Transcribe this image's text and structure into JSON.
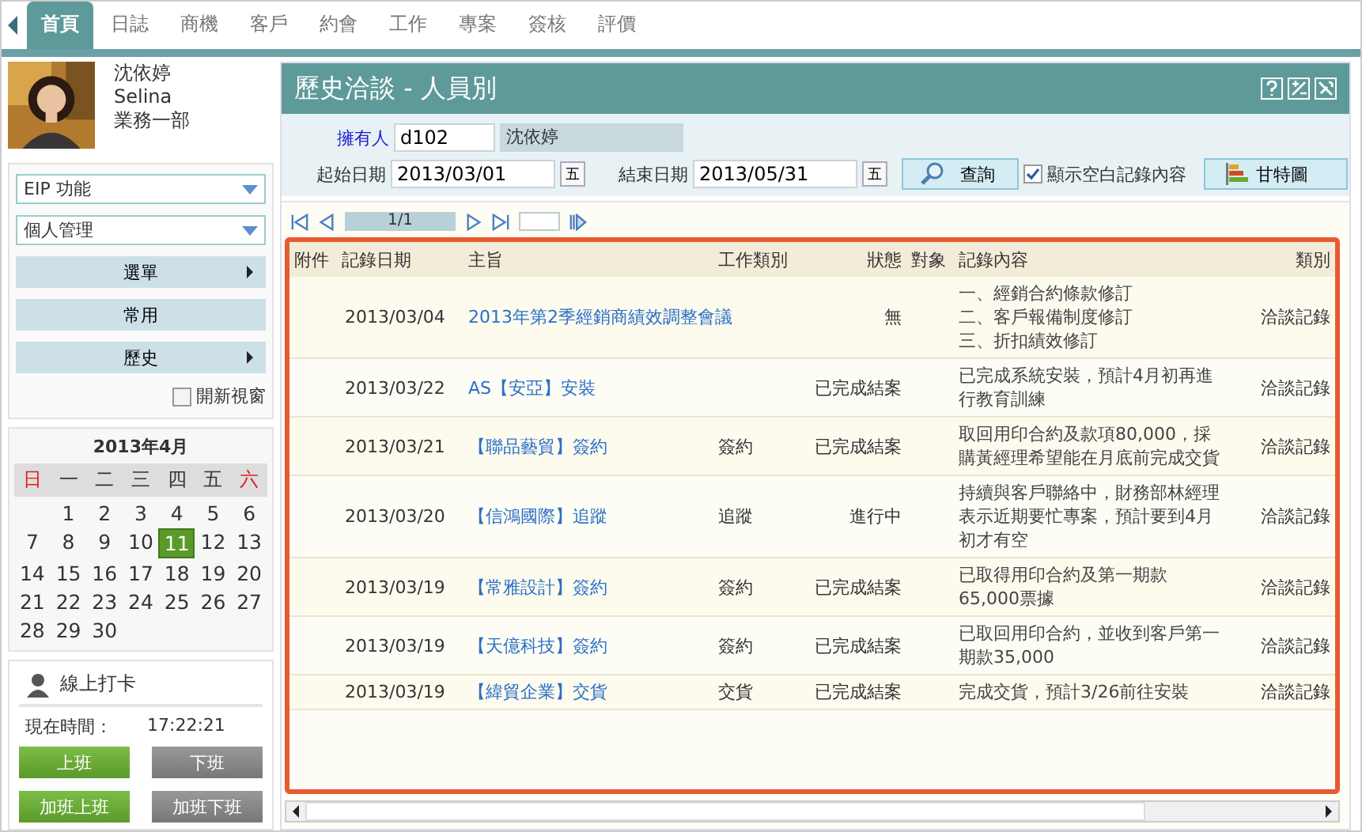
{
  "tabs": [
    {
      "label": "首頁",
      "selected": true
    },
    {
      "label": "日誌",
      "selected": false
    },
    {
      "label": "商機",
      "selected": false
    },
    {
      "label": "客戶",
      "selected": false
    },
    {
      "label": "約會",
      "selected": false
    },
    {
      "label": "工作",
      "selected": false
    },
    {
      "label": "專案",
      "selected": false
    },
    {
      "label": "簽核",
      "selected": false
    },
    {
      "label": "評價",
      "selected": false
    }
  ],
  "profile": {
    "name": "沈依婷",
    "english_name": "Selina",
    "department": "業務一部"
  },
  "sidebar": {
    "selects": [
      "EIP 功能",
      "個人管理"
    ],
    "menu": [
      {
        "label": "選單",
        "has_arrow": true
      },
      {
        "label": "常用",
        "has_arrow": false
      },
      {
        "label": "歷史",
        "has_arrow": true
      }
    ],
    "new_window": {
      "label": "開新視窗",
      "checked": false
    }
  },
  "calendar": {
    "title": "2013年4月",
    "weekdays": [
      {
        "label": "日",
        "color": "#e02020"
      },
      {
        "label": "一",
        "color": "#333333"
      },
      {
        "label": "二",
        "color": "#333333"
      },
      {
        "label": "三",
        "color": "#333333"
      },
      {
        "label": "四",
        "color": "#333333"
      },
      {
        "label": "五",
        "color": "#333333"
      },
      {
        "label": "六",
        "color": "#e02020"
      }
    ],
    "weeks": [
      [
        {
          "day": "1",
          "selected": false
        },
        {
          "day": "2",
          "selected": false
        },
        {
          "day": "3",
          "selected": false
        },
        {
          "day": "4",
          "selected": false
        },
        {
          "day": "5",
          "selected": false
        },
        {
          "day": "6",
          "selected": false
        }
      ],
      [
        {
          "day": "7",
          "selected": false
        },
        {
          "day": "8",
          "selected": false
        },
        {
          "day": "9",
          "selected": false
        },
        {
          "day": "10",
          "selected": false
        },
        {
          "day": "11",
          "selected": true
        },
        {
          "day": "12",
          "selected": false
        },
        {
          "day": "13",
          "selected": false
        }
      ],
      [
        {
          "day": "14",
          "selected": false
        },
        {
          "day": "15",
          "selected": false
        },
        {
          "day": "16",
          "selected": false
        },
        {
          "day": "17",
          "selected": false
        },
        {
          "day": "18",
          "selected": false
        },
        {
          "day": "19",
          "selected": false
        },
        {
          "day": "20",
          "selected": false
        }
      ],
      [
        {
          "day": "21",
          "selected": false
        },
        {
          "day": "22",
          "selected": false
        },
        {
          "day": "23",
          "selected": false
        },
        {
          "day": "24",
          "selected": false
        },
        {
          "day": "25",
          "selected": false
        },
        {
          "day": "26",
          "selected": false
        },
        {
          "day": "27",
          "selected": false
        }
      ],
      [
        {
          "day": "28",
          "selected": false
        },
        {
          "day": "29",
          "selected": false
        },
        {
          "day": "30",
          "selected": false
        }
      ]
    ]
  },
  "punch_clock": {
    "title": "線上打卡",
    "time_label": "現在時間：",
    "time": "17:22:21",
    "buttons": [
      {
        "label": "上班",
        "disabled": false
      },
      {
        "label": "下班",
        "disabled": true
      },
      {
        "label": "加班上班",
        "disabled": false
      },
      {
        "label": "加班下班",
        "disabled": true
      }
    ]
  },
  "page": {
    "title": "歷史洽談 - 人員別"
  },
  "filters": {
    "owner_label": "擁有人",
    "owner_id": "d102",
    "owner_name": "沈依婷",
    "start_label": "起始日期",
    "start_date": "2013/03/01",
    "end_label": "結束日期",
    "end_date": "2013/05/31",
    "start_calendar_button": "五",
    "end_calendar_button": "五",
    "search_button": "查詢",
    "show_empty": {
      "label": "顯示空白記錄內容",
      "checked": true
    },
    "gantt_button": "甘特圖"
  },
  "pager": {
    "page": "1/1"
  },
  "table": {
    "columns": [
      "附件",
      "記錄日期",
      "主旨",
      "工作類別",
      "狀態",
      "對象",
      "記錄內容",
      "類別"
    ],
    "rows": [
      {
        "date": "2013/03/04",
        "subject": "2013年第2季經銷商績效調整會議",
        "status": "無",
        "content": [
          "一、經銷合約條款修訂",
          "二、客戶報備制度修訂",
          "三、折扣績效修訂"
        ],
        "category": "洽談記錄"
      },
      {
        "date": "2013/03/22",
        "subject": "AS【安亞】安裝",
        "status": "已完成結案",
        "content": [
          "已完成系統安裝，預計4月初再進行教育訓練"
        ],
        "category": "洽談記錄"
      },
      {
        "date": "2013/03/21",
        "subject": "【聯品藝貿】簽約",
        "work_type": "簽約",
        "status": "已完成結案",
        "content": [
          "取回用印合約及款項80,000，採購黃經理希望能在月底前完成交貨"
        ],
        "category": "洽談記錄"
      },
      {
        "date": "2013/03/20",
        "subject": "【信鴻國際】追蹤",
        "work_type": "追蹤",
        "status": "進行中",
        "content": [
          "持續與客戶聯絡中，財務部林經理表示近期要忙專案，預計要到4月初才有空"
        ],
        "category": "洽談記錄"
      },
      {
        "date": "2013/03/19",
        "subject": "【常雅設計】簽約",
        "work_type": "簽約",
        "status": "已完成結案",
        "content": [
          "已取得用印合約及第一期款65,000票據"
        ],
        "category": "洽談記錄"
      },
      {
        "date": "2013/03/19",
        "subject": "【天億科技】簽約",
        "work_type": "簽約",
        "status": "已完成結案",
        "content": [
          "已取回用印合約，並收到客戶第一期款35,000"
        ],
        "category": "洽談記錄"
      },
      {
        "date": "2013/03/19",
        "subject": "【緯貿企業】交貨",
        "work_type": "交貨",
        "status": "已完成結案",
        "content": [
          "完成交貨，預計3/26前往安裝"
        ],
        "category": "洽談記錄"
      }
    ]
  }
}
